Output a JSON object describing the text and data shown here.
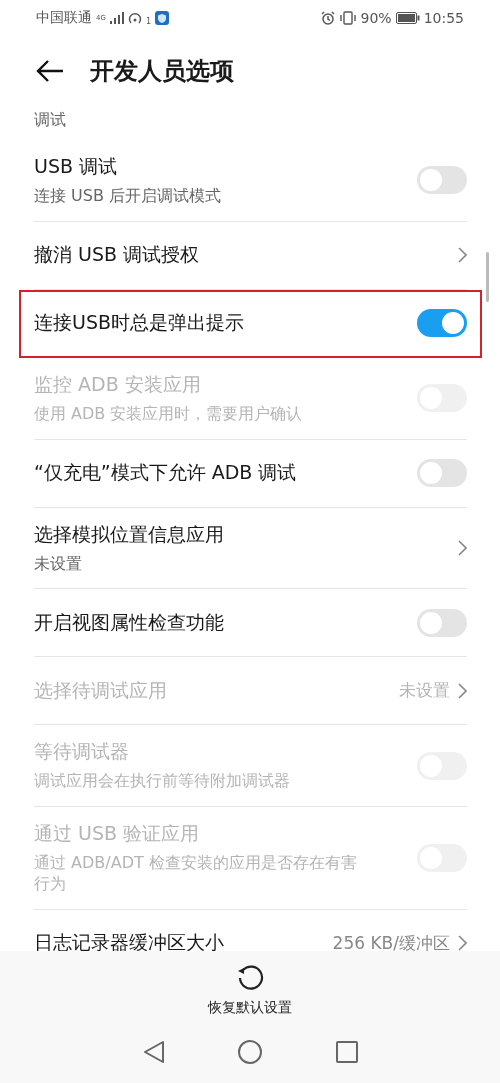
{
  "status_bar": {
    "carrier": "中国联通",
    "network": "4G",
    "hotspot_count": "1",
    "battery": "90%",
    "time": "10:55"
  },
  "header": {
    "title": "开发人员选项"
  },
  "section": {
    "title": "调试"
  },
  "rows": [
    {
      "kind": "toggle",
      "title": "USB 调试",
      "subtitle": "连接 USB 后开启调试模式",
      "on": false,
      "disabled": false,
      "highlighted": false
    },
    {
      "kind": "link",
      "title": "撤消 USB 调试授权",
      "disabled": false,
      "highlighted": false
    },
    {
      "kind": "toggle",
      "title": "连接USB时总是弹出提示",
      "on": true,
      "disabled": false,
      "highlighted": true
    },
    {
      "kind": "toggle",
      "title": "监控 ADB 安装应用",
      "subtitle": "使用 ADB 安装应用时，需要用户确认",
      "on": false,
      "disabled": true,
      "highlighted": false
    },
    {
      "kind": "toggle",
      "title": "“仅充电”模式下允许 ADB 调试",
      "on": false,
      "disabled": false,
      "highlighted": false
    },
    {
      "kind": "link",
      "title": "选择模拟位置信息应用",
      "subtitle": "未设置",
      "disabled": false,
      "highlighted": false
    },
    {
      "kind": "toggle",
      "title": "开启视图属性检查功能",
      "on": false,
      "disabled": false,
      "highlighted": false
    },
    {
      "kind": "link",
      "title": "选择待调试应用",
      "value": "未设置",
      "disabled": true,
      "highlighted": false
    },
    {
      "kind": "toggle",
      "title": "等待调试器",
      "subtitle": "调试应用会在执行前等待附加调试器",
      "on": false,
      "disabled": true,
      "highlighted": false
    },
    {
      "kind": "toggle",
      "title": "通过 USB 验证应用",
      "subtitle": "通过 ADB/ADT 检查安装的应用是否存在有害行为",
      "on": false,
      "disabled": true,
      "highlighted": false
    },
    {
      "kind": "link",
      "title": "日志记录器缓冲区大小",
      "value": "256 KB/缓冲区",
      "disabled": false,
      "highlighted": false
    }
  ],
  "bottom_action": {
    "label": "恢复默认设置"
  }
}
